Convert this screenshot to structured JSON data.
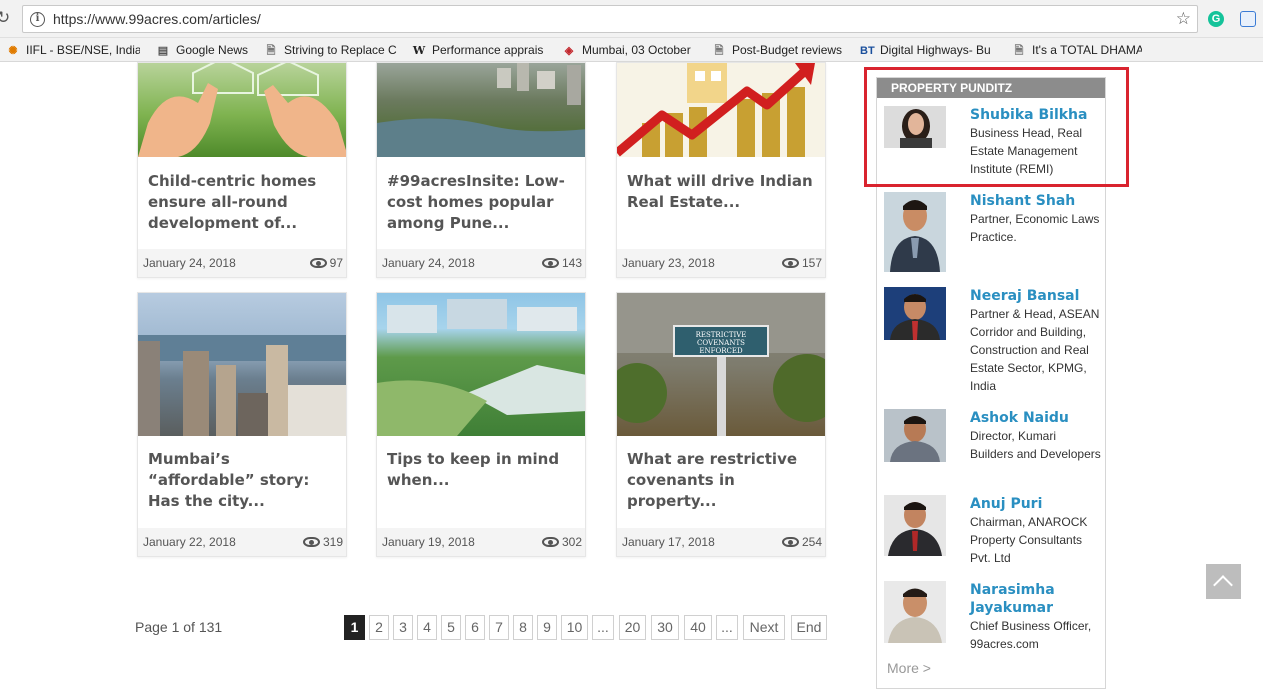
{
  "browser": {
    "url": "https://www.99acres.com/articles/",
    "bookmarks": [
      {
        "icon": "iifl-icon",
        "label": "IIFL - BSE/NSE, India"
      },
      {
        "icon": "google-news-icon",
        "label": "Google News"
      },
      {
        "icon": "page-icon",
        "label": "Striving to Replace C"
      },
      {
        "icon": "wikipedia-icon",
        "label": "Performance apprais"
      },
      {
        "icon": "news-icon",
        "label": "Mumbai, 03 October"
      },
      {
        "icon": "page-icon",
        "label": "Post-Budget reviews"
      },
      {
        "icon": "bt-icon",
        "label": "Digital Highways- Bu"
      },
      {
        "icon": "page-icon",
        "label": "It's a TOTAL DHAMA"
      }
    ]
  },
  "articles": [
    {
      "title": "Child-centric homes ensure all-round development of...",
      "date": "January 24, 2018",
      "views": "97"
    },
    {
      "title": "#99acresInsite: Low-cost homes popular among Pune...",
      "date": "January 24, 2018",
      "views": "143"
    },
    {
      "title": "What will drive Indian Real Estate...",
      "date": "January 23, 2018",
      "views": "157"
    },
    {
      "title": "Mumbai’s “affordable” story: Has the city...",
      "date": "January 22, 2018",
      "views": "319"
    },
    {
      "title": "Tips to keep in mind when...",
      "date": "January 19, 2018",
      "views": "302"
    },
    {
      "title": "What are restrictive covenants in property...",
      "date": "January 17, 2018",
      "views": "254"
    }
  ],
  "signboard_text": "RESTRICTIVE COVENANTS ENFORCED",
  "pagination": {
    "info": "Page 1 of 131",
    "pages": [
      "1",
      "2",
      "3",
      "4",
      "5",
      "6",
      "7",
      "8",
      "9",
      "10",
      "...",
      "20",
      "30",
      "40",
      "...",
      "Next",
      "End"
    ],
    "active": "1"
  },
  "sidebar": {
    "heading": "PROPERTY PUNDITZ",
    "pundits": [
      {
        "name": "Shubika Bilkha",
        "role": "Business Head, Real Estate Management Institute (REMI)"
      },
      {
        "name": "Nishant Shah",
        "role": "Partner, Economic Laws Practice."
      },
      {
        "name": "Neeraj Bansal",
        "role": "Partner & Head, ASEAN Corridor and Building, Construction and Real Estate Sector, KPMG, India"
      },
      {
        "name": "Ashok Naidu",
        "role": "Director, Kumari Builders and Developers"
      },
      {
        "name": "Anuj Puri",
        "role": "Chairman, ANAROCK Property Consultants Pvt. Ltd"
      },
      {
        "name": "Narasimha Jayakumar",
        "role": "Chief Business Officer, 99acres.com"
      }
    ],
    "more": "More >"
  },
  "colors": {
    "highlight": "#d9232e",
    "name_link": "#2a8fc1",
    "sidebar_head": "#8c8c8c"
  }
}
